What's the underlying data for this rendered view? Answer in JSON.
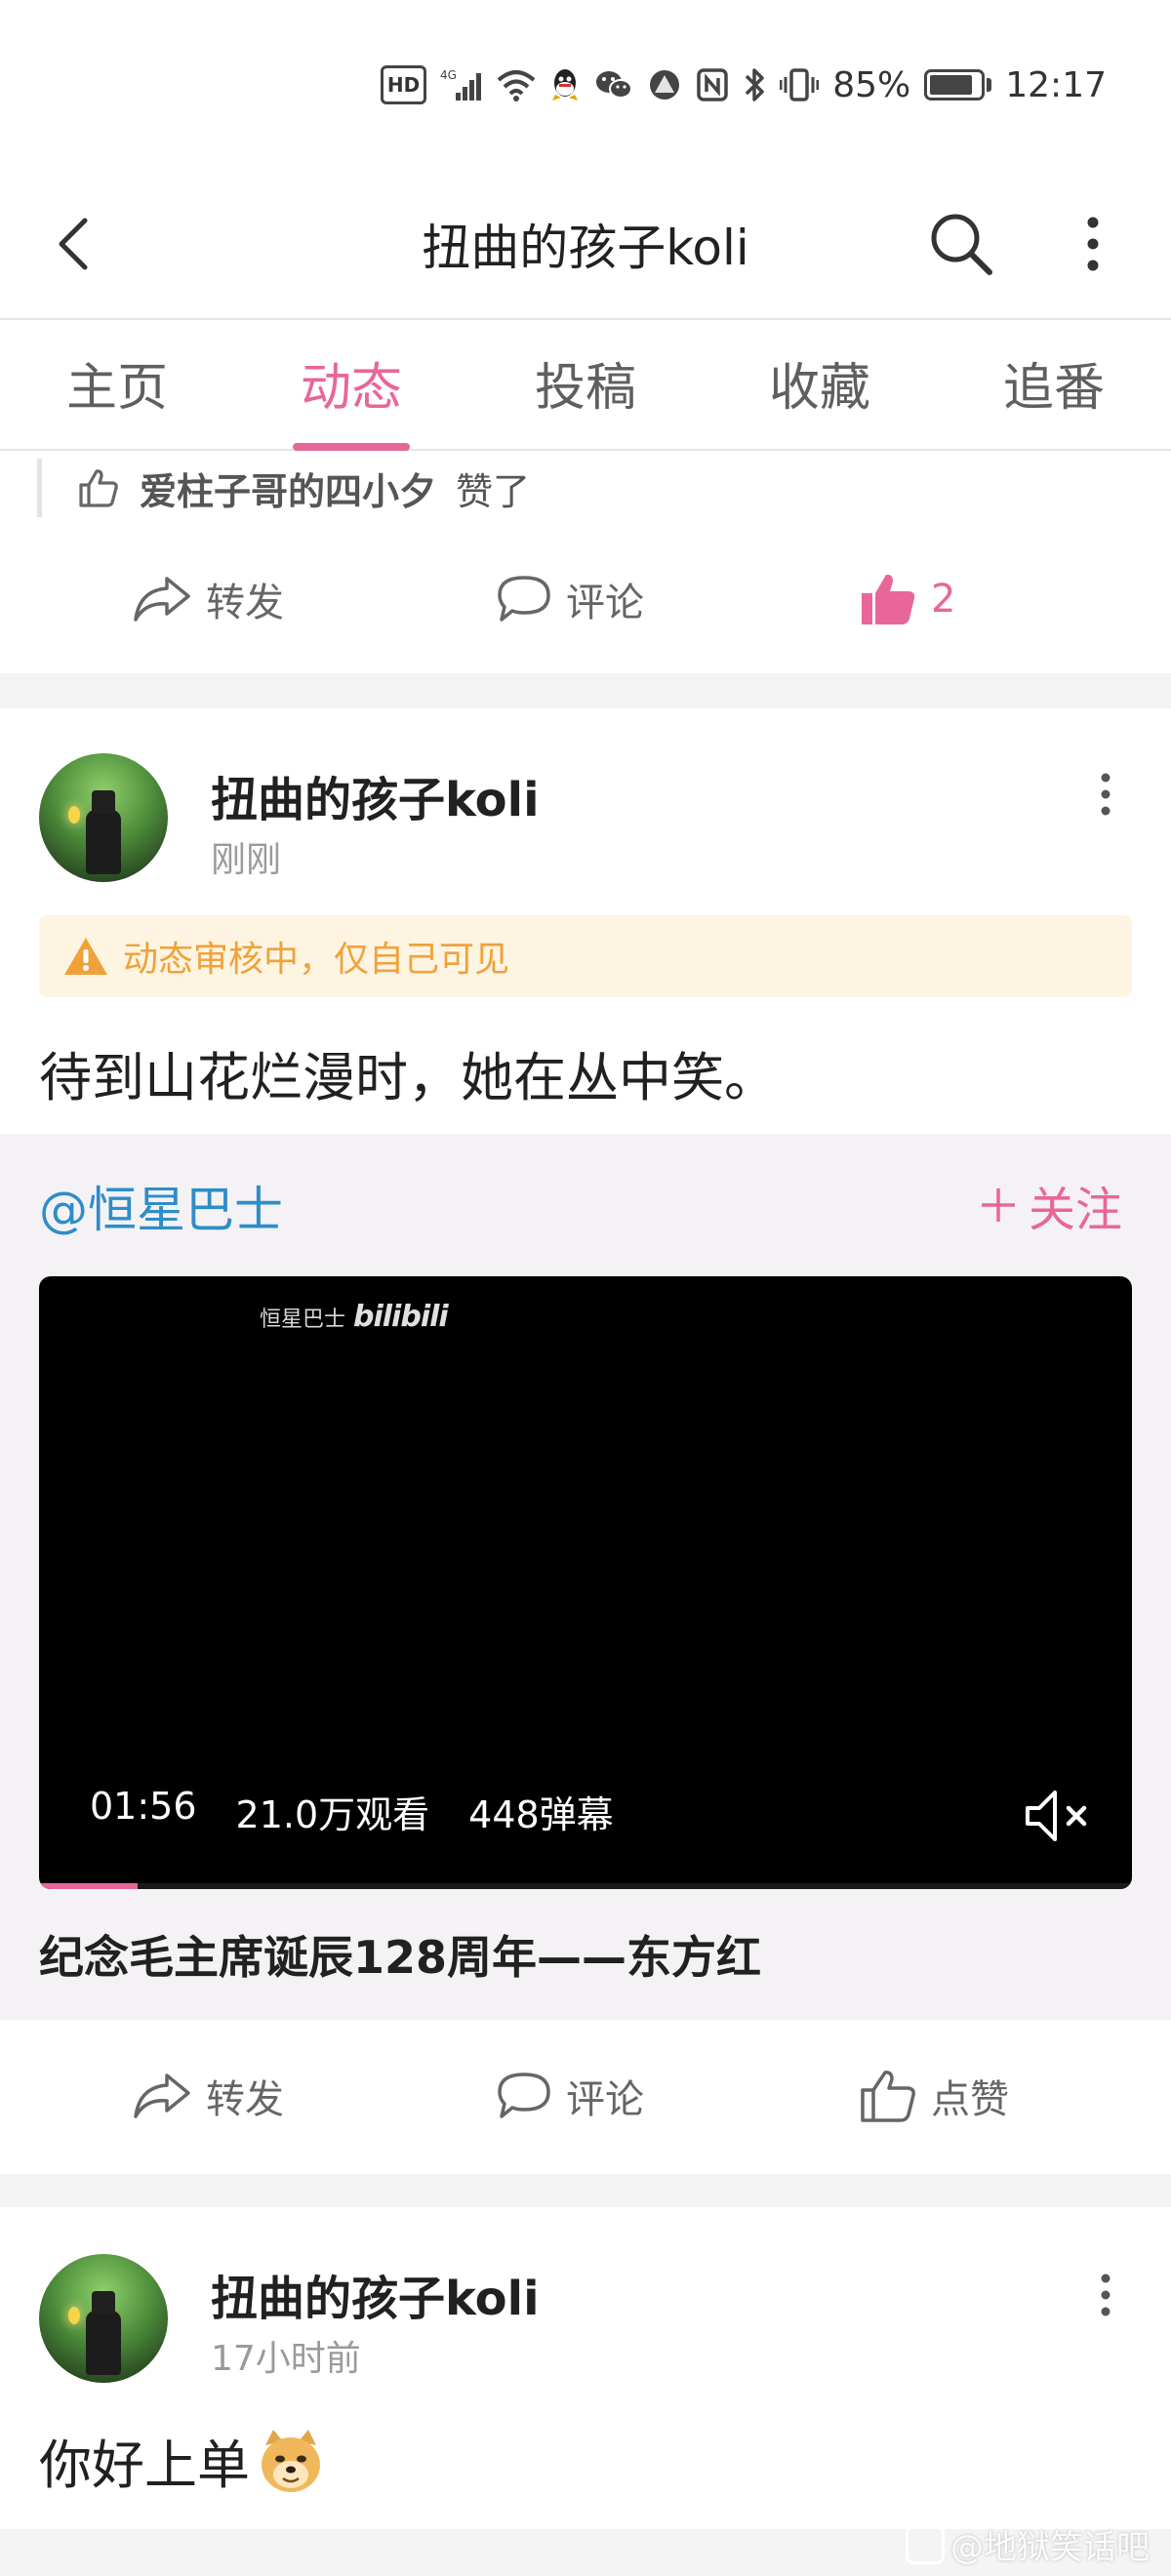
{
  "status_bar": {
    "hd": "HD",
    "network": "4G",
    "battery_percent": "85%",
    "battery_level": 0.85,
    "time": "12:17"
  },
  "header": {
    "title": "扭曲的孩子koli"
  },
  "tabs": [
    {
      "label": "主页",
      "active": false
    },
    {
      "label": "动态",
      "active": true
    },
    {
      "label": "投稿",
      "active": false
    },
    {
      "label": "收藏",
      "active": false
    },
    {
      "label": "追番",
      "active": false
    }
  ],
  "prev_post": {
    "liked_by": "爱柱子哥的四小夕",
    "liked_suffix": "赞了",
    "actions": {
      "share": "转发",
      "comment": "评论",
      "like_count": "2"
    }
  },
  "post1": {
    "user": "扭曲的孩子koli",
    "time": "刚刚",
    "review_notice": "动态审核中，仅自己可见",
    "text": "待到山花烂漫时，她在丛中笑。",
    "repost": {
      "user": "@恒星巴士",
      "follow_label": "关注",
      "video": {
        "watermark_name": "恒星巴士",
        "watermark_brand": "bilibili",
        "duration": "01:56",
        "views": "21.0万观看",
        "danmaku": "448弹幕",
        "progress": 0.09
      },
      "title": "纪念毛主席诞辰128周年——东方红"
    },
    "actions": {
      "share": "转发",
      "comment": "评论",
      "like": "点赞"
    }
  },
  "post2": {
    "user": "扭曲的孩子koli",
    "time": "17小时前",
    "text": "你好上单"
  },
  "corner_watermark": "@地狱笑话吧",
  "colors": {
    "accent": "#e8669a",
    "link": "#2f8dc8",
    "warning": "#f0a23a",
    "warning_bg": "#fdf4e2"
  }
}
